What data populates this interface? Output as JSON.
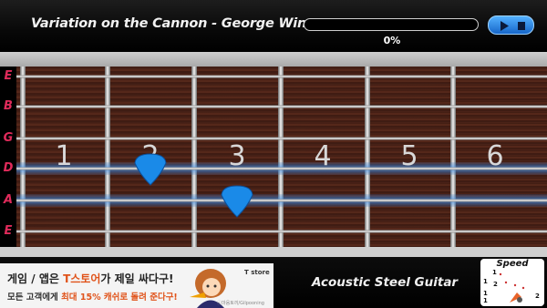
{
  "header": {
    "song_title": "Variation on the Cannon - George Winston",
    "progress_text": "0%",
    "progress_value": 0
  },
  "fretboard": {
    "string_labels": [
      "E",
      "B",
      "G",
      "D",
      "A",
      "E"
    ],
    "fret_numbers": [
      "1",
      "2",
      "3",
      "4",
      "5",
      "6"
    ],
    "highlighted_strings": [
      "D",
      "A"
    ],
    "picks": [
      {
        "string": "D",
        "fret": 2
      },
      {
        "string": "A",
        "fret": 3
      }
    ]
  },
  "instrument_label": "Acoustic Steel Guitar",
  "ad": {
    "line1_a": "게임 / 앱은 ",
    "line1_hl": "T스토어",
    "line1_b": "가 제일 싸다구!",
    "line2_a": "모든 고객에게 ",
    "line2_hl": "최대 15% 캐쉬로 돌려 준다구!",
    "brand": "T store",
    "credit": "ⓒ마음토끼/Gilpooning"
  },
  "speed": {
    "title": "Speed",
    "labels": [
      "1",
      "1",
      "2",
      "1",
      "1",
      "2"
    ]
  },
  "colors": {
    "accent_blue": "#2f8cf0",
    "string_label": "#e02b5b",
    "wood": "#4a1f16"
  }
}
